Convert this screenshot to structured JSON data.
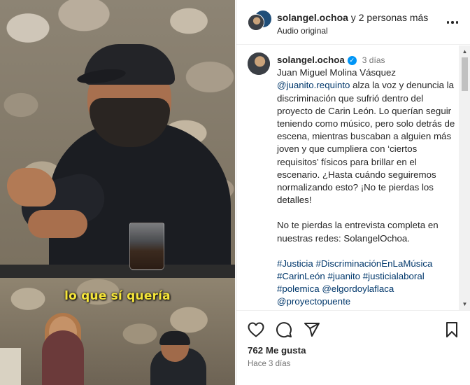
{
  "media": {
    "subtitle": "lo que sí quería"
  },
  "header": {
    "username": "solangel.ochoa",
    "others": " y 2 personas más",
    "audio": "Audio original"
  },
  "caption": {
    "username": "solangel.ochoa",
    "time": "3 días",
    "verified_symbol": "✓",
    "text_before_mention": "Juan Miguel Molina Vásquez",
    "mention": "@juanito.requinto",
    "text_after_mention": " alza la voz y denuncia la discriminación que sufrió dentro del proyecto de Carin León. Lo querían seguir teniendo como músico, pero solo detrás de escena, mientras buscaban a alguien más joven y que cumpliera con ‘ciertos requisitos’ físicos para brillar en el escenario. ¿Hasta cuándo seguiremos normalizando esto? ¡No te pierdas los detalles!",
    "paragraph2": "No te pierdas la entrevista completa en nuestras redes: SolangelOchoa.",
    "hashtags": [
      "#Justicia",
      "#DiscriminaciónEnLaMúsica",
      "#CarinLeón",
      "#juanito",
      "#justicialaboral",
      "#polemica",
      "@elgordoylaflaca",
      "@proyectopuente"
    ]
  },
  "actions": {
    "likes": "762 Me gusta",
    "posted": "Hace 3 días"
  },
  "icons": {
    "like": "heart-icon",
    "comment": "comment-icon",
    "share": "share-icon",
    "save": "bookmark-icon",
    "more": "more-icon"
  },
  "colors": {
    "link": "#00376b",
    "verified": "#0095f6",
    "subtitle": "#f5e53a"
  }
}
